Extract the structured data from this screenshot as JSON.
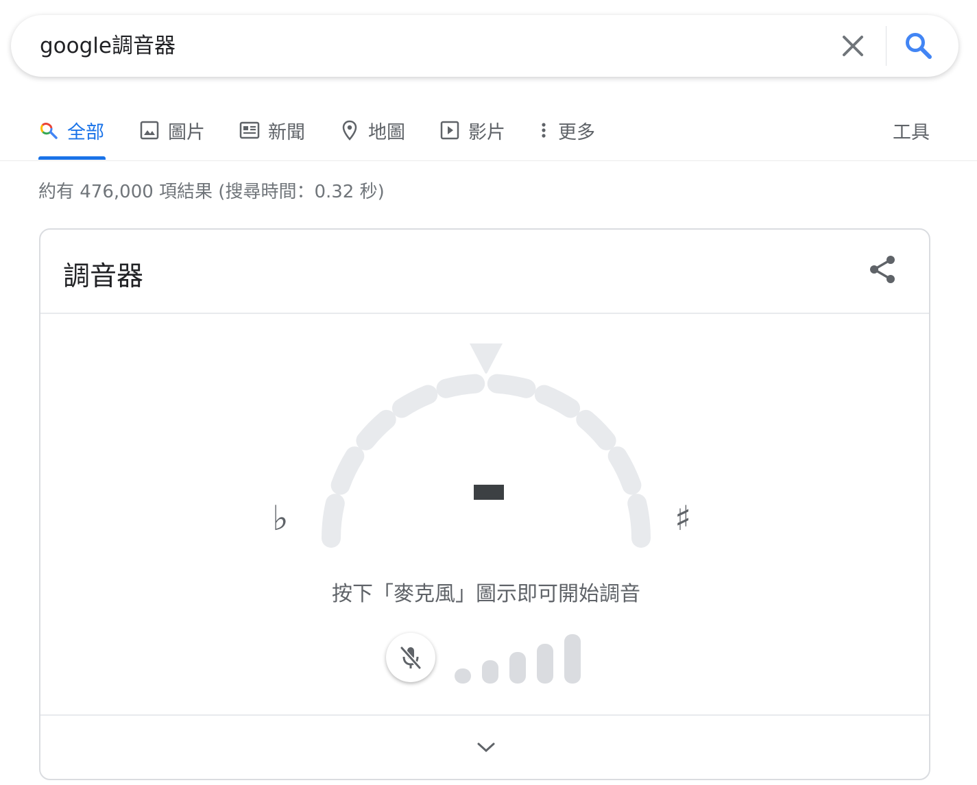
{
  "search": {
    "query": "google調音器"
  },
  "tabs": [
    {
      "label": "全部",
      "icon": "search-icon",
      "active": true
    },
    {
      "label": "圖片",
      "icon": "image-icon"
    },
    {
      "label": "新聞",
      "icon": "news-icon"
    },
    {
      "label": "地圖",
      "icon": "map-pin-icon"
    },
    {
      "label": "影片",
      "icon": "play-icon"
    },
    {
      "label": "更多",
      "icon": "more-vert-icon"
    }
  ],
  "tools_label": "工具",
  "result_stats": "約有 476,000 項結果 (搜尋時間：0.32 秒)",
  "tuner": {
    "title": "調音器",
    "flat_symbol": "♭",
    "sharp_symbol": "♯",
    "instruction": "按下「麥克風」圖示即可開始調音",
    "level_bars": 5
  },
  "colors": {
    "accent": "#1a73e8",
    "text_secondary": "#5f6368",
    "gauge_segment": "#e8eaed",
    "level_bar": "#dadce0"
  }
}
